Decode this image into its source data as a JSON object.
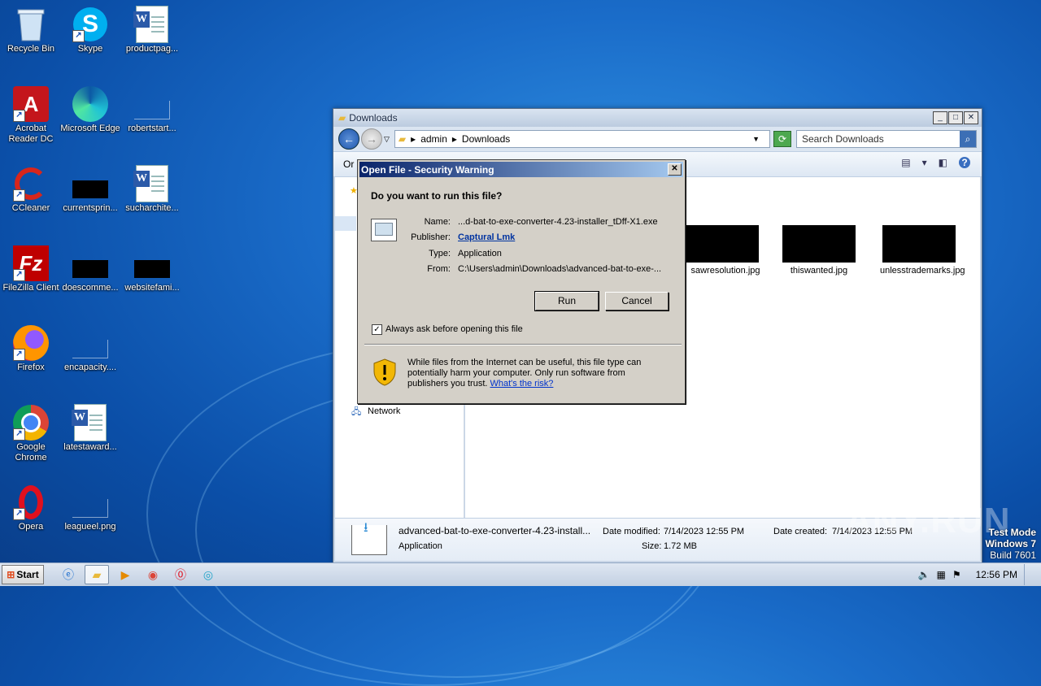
{
  "desktop": {
    "icons": [
      {
        "label": "Recycle Bin"
      },
      {
        "label": "Skype"
      },
      {
        "label": "productpag..."
      },
      {
        "label": "Acrobat Reader DC"
      },
      {
        "label": "Microsoft Edge"
      },
      {
        "label": "robertstart..."
      },
      {
        "label": "CCleaner"
      },
      {
        "label": "currentsprin..."
      },
      {
        "label": "sucharchite..."
      },
      {
        "label": "FileZilla Client"
      },
      {
        "label": "doescomme..."
      },
      {
        "label": "websitefami..."
      },
      {
        "label": "Firefox"
      },
      {
        "label": "encapacity...."
      },
      {
        "label": "Google Chrome"
      },
      {
        "label": "latestaward..."
      },
      {
        "label": "Opera"
      },
      {
        "label": "leagueel.png"
      }
    ]
  },
  "explorer": {
    "title": "Downloads",
    "breadcrumb": [
      "admin",
      "Downloads"
    ],
    "search_placeholder": "Search Downloads",
    "toolbar_partial": "Or",
    "nav_network": "Network",
    "files": [
      {
        "name": "sawresolution.jpg"
      },
      {
        "name": "thiswanted.jpg"
      },
      {
        "name": "unlesstrademarks.jpg"
      }
    ],
    "details": {
      "filename": "advanced-bat-to-exe-converter-4.23-install...",
      "type": "Application",
      "date_modified_label": "Date modified:",
      "date_modified": "7/14/2023 12:55 PM",
      "size_label": "Size:",
      "size": "1.72 MB",
      "date_created_label": "Date created:",
      "date_created": "7/14/2023 12:55 PM"
    }
  },
  "dialog": {
    "title": "Open File - Security Warning",
    "question": "Do you want to run this file?",
    "name_label": "Name:",
    "name_value": "...d-bat-to-exe-converter-4.23-installer_tDff-X1.exe",
    "publisher_label": "Publisher:",
    "publisher_value": "Captural Lmk",
    "type_label": "Type:",
    "type_value": "Application",
    "from_label": "From:",
    "from_value": "C:\\Users\\admin\\Downloads\\advanced-bat-to-exe-...",
    "run_label": "Run",
    "cancel_label": "Cancel",
    "checkbox_label": "Always ask before opening this file",
    "checkbox_checked": true,
    "warning_text": "While files from the Internet can be useful, this file type can potentially harm your computer. Only run software from publishers you trust.",
    "risk_link": "What's the risk?"
  },
  "taskbar": {
    "start_label": "Start",
    "clock": "12:56 PM"
  },
  "watermark": {
    "line1": "Test Mode",
    "line2": "Windows 7",
    "line3": "Build 7601",
    "brand": "ANY.RUN"
  }
}
